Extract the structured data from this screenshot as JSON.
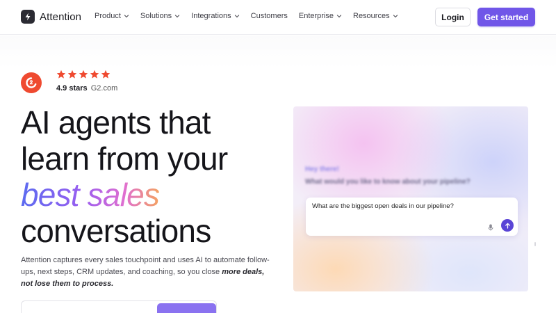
{
  "nav": {
    "brand": "Attention",
    "links": [
      {
        "label": "Product",
        "dropdown": true
      },
      {
        "label": "Solutions",
        "dropdown": true
      },
      {
        "label": "Integrations",
        "dropdown": true
      },
      {
        "label": "Customers",
        "dropdown": false
      },
      {
        "label": "Enterprise",
        "dropdown": true
      },
      {
        "label": "Resources",
        "dropdown": true
      }
    ],
    "login_label": "Login",
    "cta_label": "Get started"
  },
  "rating": {
    "badge_icon": "g2-logo-icon",
    "stars": 5,
    "score_text": "4.9 stars",
    "source_text": "G2.com"
  },
  "hero": {
    "line1": "AI agents that",
    "line2": "learn from your",
    "highlight": "best sales",
    "line4": "conversations",
    "subtitle_plain": "Attention captures every sales touchpoint and uses AI to automate follow-ups, next steps, CRM updates, and coaching, so you close ",
    "subtitle_emphasis": "more deals, not lose them to process."
  },
  "panel": {
    "greeting": "Hey there!",
    "question": "What would you like to know about your pipeline?",
    "prompt_text": "What are the biggest open deals in our pipeline?"
  },
  "colors": {
    "accent": "#7056e8",
    "g2_red": "#ef4a30",
    "star": "#ef4a30",
    "send_button": "#5a45d6"
  }
}
